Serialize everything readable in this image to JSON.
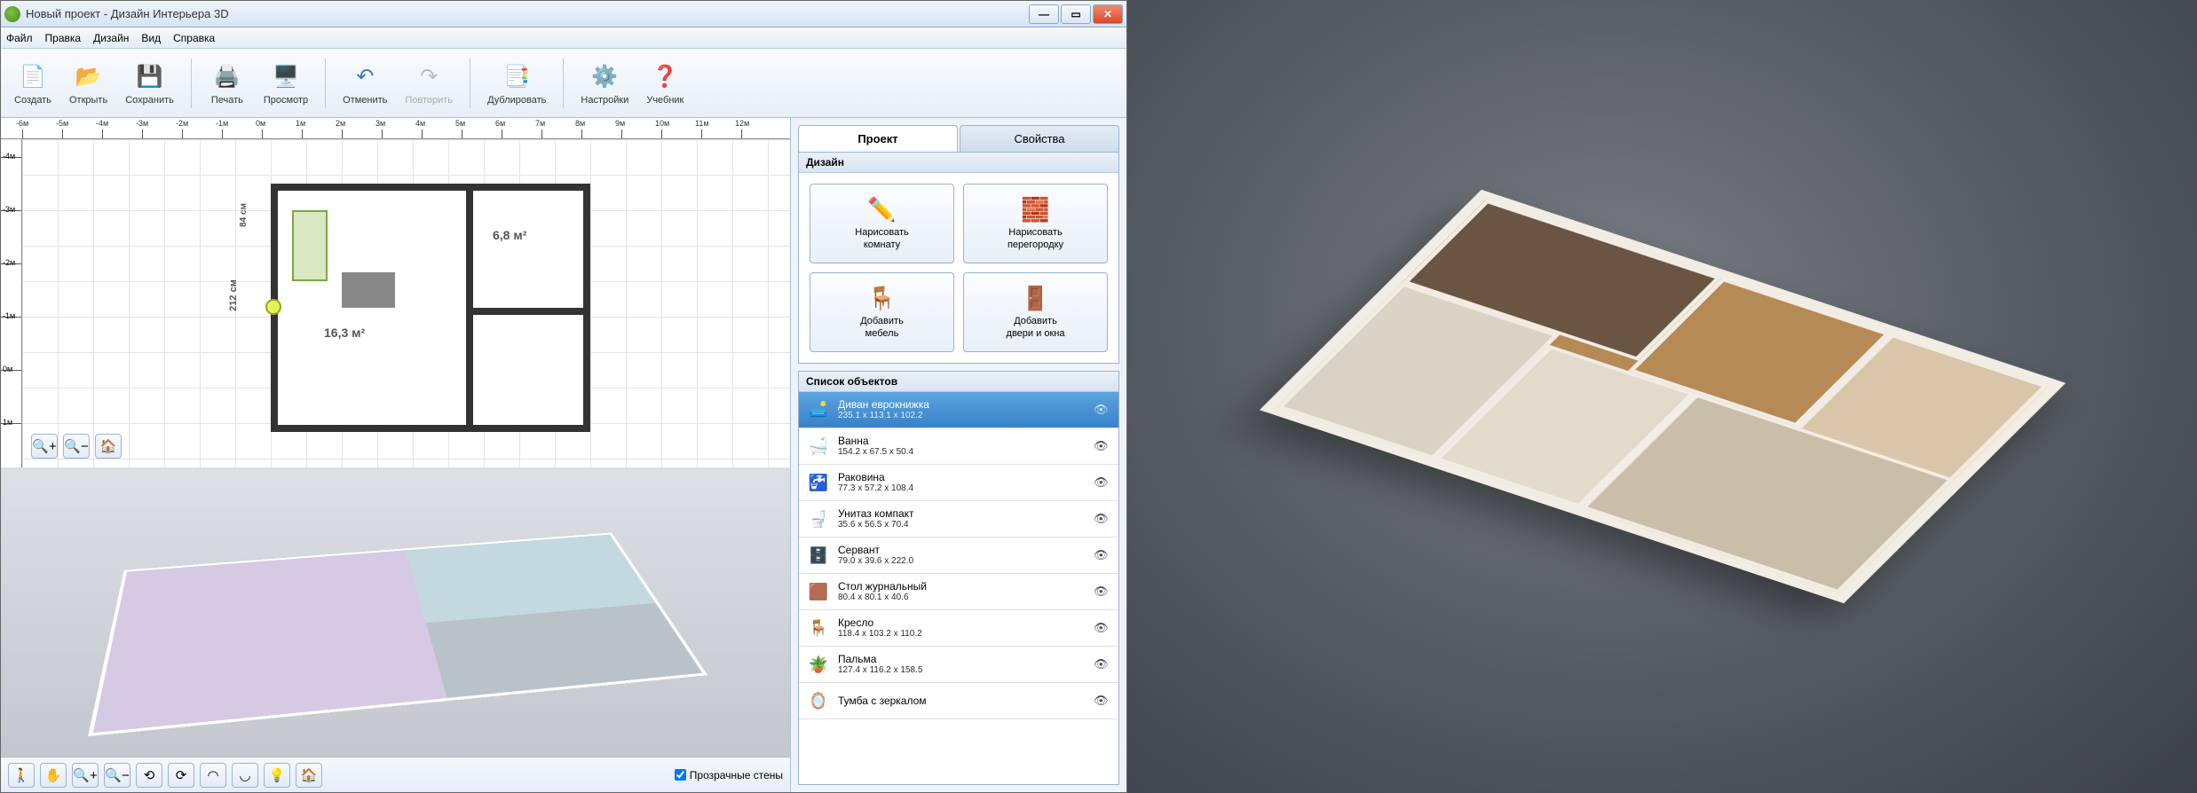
{
  "window": {
    "title": "Новый проект - Дизайн Интерьера 3D"
  },
  "menu": {
    "file": "Файл",
    "edit": "Правка",
    "design": "Дизайн",
    "view": "Вид",
    "help": "Справка"
  },
  "toolbar": {
    "create": "Создать",
    "open": "Открыть",
    "save": "Сохранить",
    "print": "Печать",
    "preview": "Просмотр",
    "undo": "Отменить",
    "redo": "Повторить",
    "duplicate": "Дублировать",
    "settings": "Настройки",
    "tutorial": "Учебник"
  },
  "ruler": {
    "h": [
      "-6м",
      "-5м",
      "-4м",
      "-3м",
      "-2м",
      "-1м",
      "0м",
      "1м",
      "2м",
      "3м",
      "4м",
      "5м",
      "6м",
      "7м",
      "8м",
      "9м",
      "10м",
      "11м",
      "12м"
    ],
    "v": [
      "-4м",
      "-3м",
      "-2м",
      "-1м",
      "0м",
      "1м"
    ]
  },
  "plan": {
    "room1_area": "16,3 м²",
    "room2_area": "6,8 м²",
    "dim_height": "212 см",
    "dim_small": "84 см"
  },
  "footer": {
    "transparent_walls": "Прозрачные стены"
  },
  "tabs": {
    "project": "Проект",
    "properties": "Свойства"
  },
  "design": {
    "header": "Дизайн",
    "draw_room_l1": "Нарисовать",
    "draw_room_l2": "комнату",
    "draw_wall_l1": "Нарисовать",
    "draw_wall_l2": "перегородку",
    "add_furn_l1": "Добавить",
    "add_furn_l2": "мебель",
    "add_doors_l1": "Добавить",
    "add_doors_l2": "двери и окна"
  },
  "objects": {
    "header": "Список объектов",
    "items": [
      {
        "name": "Диван еврокнижка",
        "dim": "235.1 x 113.1 x 102.2",
        "selected": true,
        "icon": "🛋️"
      },
      {
        "name": "Ванна",
        "dim": "154.2 x 67.5 x 50.4",
        "icon": "🛁"
      },
      {
        "name": "Раковина",
        "dim": "77.3 x 57.2 x 108.4",
        "icon": "🚰"
      },
      {
        "name": "Унитаз компакт",
        "dim": "35.6 x 56.5 x 70.4",
        "icon": "🚽"
      },
      {
        "name": "Сервант",
        "dim": "79.0 x 39.6 x 222.0",
        "icon": "🗄️"
      },
      {
        "name": "Стол журнальный",
        "dim": "80.4 x 80.1 x 40.6",
        "icon": "🟫"
      },
      {
        "name": "Кресло",
        "dim": "118.4 x 103.2 x 110.2",
        "icon": "🪑"
      },
      {
        "name": "Пальма",
        "dim": "127.4 x 116.2 x 158.5",
        "icon": "🪴"
      },
      {
        "name": "Тумба с зеркалом",
        "dim": "",
        "icon": "🪞"
      }
    ]
  }
}
